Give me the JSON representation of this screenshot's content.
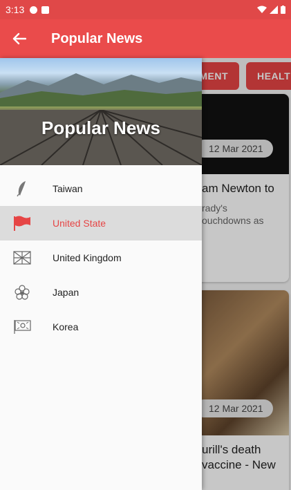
{
  "status_bar": {
    "time": "3:13"
  },
  "app_bar": {
    "title": "Popular News"
  },
  "tabs": [
    {
      "label": "IMENT"
    },
    {
      "label": "HEALT"
    }
  ],
  "cards": [
    {
      "date": "12 Mar 2021",
      "title": "am Newton to",
      "subtitle": "rady's\nouchdowns as"
    },
    {
      "date": "12 Mar 2021",
      "title": "urill's death\nvaccine - New"
    }
  ],
  "drawer": {
    "title": "Popular News",
    "items": [
      {
        "label": "Taiwan",
        "icon": "feather-icon"
      },
      {
        "label": "United State",
        "icon": "flag-icon",
        "active": true
      },
      {
        "label": "United Kingdom",
        "icon": "uk-flag-icon"
      },
      {
        "label": "Japan",
        "icon": "flower-icon"
      },
      {
        "label": "Korea",
        "icon": "korea-flag-icon"
      }
    ]
  },
  "colors": {
    "primary": "#ea4b4b",
    "status_bar": "#e04848",
    "active_item_bg": "#dcdcdc",
    "active_text": "#e64545"
  }
}
